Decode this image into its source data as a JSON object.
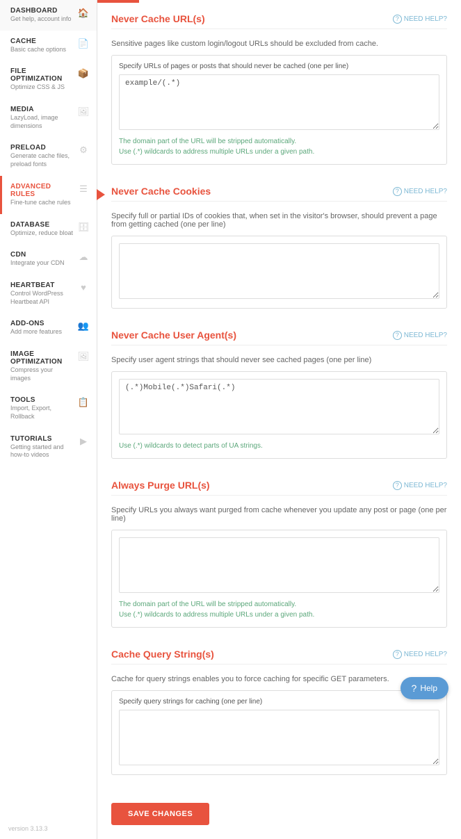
{
  "sidebar": {
    "items": [
      {
        "id": "dashboard",
        "title": "DASHBOARD",
        "subtitle": "Get help, account info",
        "icon": "🏠",
        "active": false
      },
      {
        "id": "cache",
        "title": "CACHE",
        "subtitle": "Basic cache options",
        "icon": "📄",
        "active": false
      },
      {
        "id": "file-optimization",
        "title": "FILE OPTIMIZATION",
        "subtitle": "Optimize CSS & JS",
        "icon": "📦",
        "active": false
      },
      {
        "id": "media",
        "title": "MEDIA",
        "subtitle": "LazyLoad, image dimensions",
        "icon": "🖼",
        "active": false
      },
      {
        "id": "preload",
        "title": "PRELOAD",
        "subtitle": "Generate cache files, preload fonts",
        "icon": "⚙",
        "active": false
      },
      {
        "id": "advanced-rules",
        "title": "ADVANCED RULES",
        "subtitle": "Fine-tune cache rules",
        "icon": "☰",
        "active": true
      },
      {
        "id": "database",
        "title": "DATABASE",
        "subtitle": "Optimize, reduce bloat",
        "icon": "🗄",
        "active": false
      },
      {
        "id": "cdn",
        "title": "CDN",
        "subtitle": "Integrate your CDN",
        "icon": "☁",
        "active": false
      },
      {
        "id": "heartbeat",
        "title": "HEARTBEAT",
        "subtitle": "Control WordPress Heartbeat API",
        "icon": "♥",
        "active": false
      },
      {
        "id": "add-ons",
        "title": "ADD-ONS",
        "subtitle": "Add more features",
        "icon": "👥",
        "active": false
      },
      {
        "id": "image-optimization",
        "title": "IMAGE OPTIMIZATION",
        "subtitle": "Compress your images",
        "icon": "🖼",
        "active": false
      },
      {
        "id": "tools",
        "title": "TOOLS",
        "subtitle": "Import, Export, Rollback",
        "icon": "📋",
        "active": false
      },
      {
        "id": "tutorials",
        "title": "TUTORIALS",
        "subtitle": "Getting started and how-to videos",
        "icon": "▶",
        "active": false
      }
    ],
    "version": "version 3.13.3"
  },
  "sections": [
    {
      "id": "never-cache-urls",
      "title": "Never Cache URL(s)",
      "need_help": "NEED HELP?",
      "description": "Sensitive pages like custom login/logout URLs should be excluded from cache.",
      "field_label": "Specify URLs of pages or posts that should never be cached (one per line)",
      "textarea_value": "example/(.*)",
      "textarea_placeholder": "",
      "hints": [
        "The domain part of the URL will be stripped automatically.",
        "Use (.*) wildcards to address multiple URLs under a given path."
      ]
    },
    {
      "id": "never-cache-cookies",
      "title": "Never Cache Cookies",
      "need_help": "NEED HELP?",
      "description": "Specify full or partial IDs of cookies that, when set in the visitor's browser, should prevent a page from getting cached (one per line)",
      "field_label": "",
      "textarea_value": "",
      "textarea_placeholder": "",
      "hints": []
    },
    {
      "id": "never-cache-user-agents",
      "title": "Never Cache User Agent(s)",
      "need_help": "NEED HELP?",
      "description": "Specify user agent strings that should never see cached pages (one per line)",
      "field_label": "",
      "textarea_value": "(.*)Mobile(.*)Safari(.*)",
      "textarea_placeholder": "",
      "hints": [
        "Use (.*) wildcards to detect parts of UA strings."
      ]
    },
    {
      "id": "always-purge-urls",
      "title": "Always Purge URL(s)",
      "need_help": "NEED HELP?",
      "description": "Specify URLs you always want purged from cache whenever you update any post or page (one per line)",
      "field_label": "",
      "textarea_value": "",
      "textarea_placeholder": "",
      "hints": [
        "The domain part of the URL will be stripped automatically.",
        "Use (.*) wildcards to address multiple URLs under a given path."
      ]
    },
    {
      "id": "cache-query-strings",
      "title": "Cache Query String(s)",
      "need_help": "NEED HELP?",
      "description": "Cache for query strings enables you to force caching for specific GET parameters.",
      "field_label": "Specify query strings for caching (one per line)",
      "textarea_value": "",
      "textarea_placeholder": "",
      "hints": []
    }
  ],
  "save_button": "SAVE CHANGES",
  "help_button": "Help"
}
